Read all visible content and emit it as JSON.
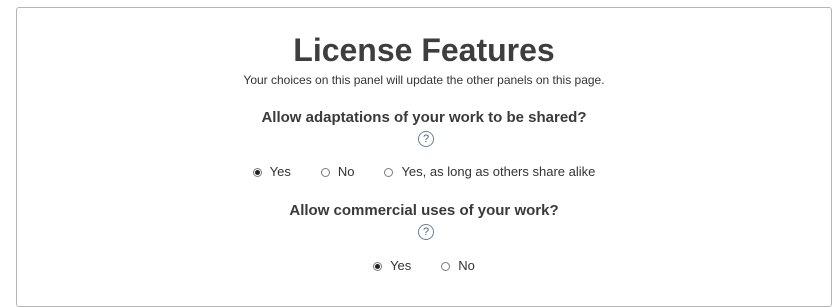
{
  "panel": {
    "title": "License Features",
    "subtitle": "Your choices on this panel will update the other panels on this page."
  },
  "adaptations": {
    "question": "Allow adaptations of your work to be shared?",
    "help_glyph": "?",
    "options": [
      {
        "label": "Yes",
        "checked": true
      },
      {
        "label": "No",
        "checked": false
      },
      {
        "label": "Yes, as long as others share alike",
        "checked": false
      }
    ]
  },
  "commercial": {
    "question": "Allow commercial uses of your work?",
    "help_glyph": "?",
    "options": [
      {
        "label": "Yes",
        "checked": true
      },
      {
        "label": "No",
        "checked": false
      }
    ]
  }
}
